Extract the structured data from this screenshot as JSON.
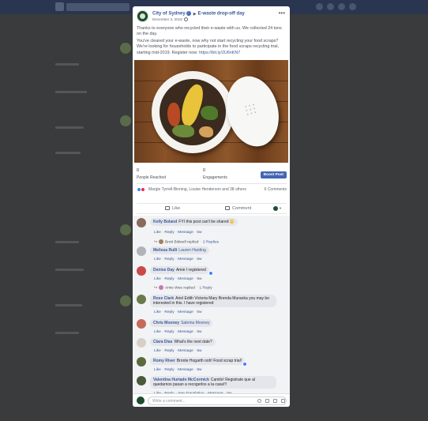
{
  "post": {
    "page_name": "City of Sydney",
    "event_name": "E-waste drop-off day",
    "date": "December 3, 2018",
    "paragraph_1": "Thanks to everyone who recycled their e-waste with us. We collected 24 tons on the day.",
    "paragraph_2": "You've cleared your e-waste, now why not start recycling your food scraps? We're looking for households to participate in the food scraps recycling trial, starting mid-2019. Register now:",
    "link": "https://bit.ly/2U6nKN7"
  },
  "stats": {
    "reached_count": "0",
    "reached_label": "People Reached",
    "engagements_count": "0",
    "engagements_label": "Engagements",
    "boost_label": "Boost Post"
  },
  "reactions": {
    "names": "Margie Tyrrell-Binning, Louise Henderson and 38 others",
    "comment_count": "6 Comments"
  },
  "actions": {
    "like": "Like",
    "comment": "Comment"
  },
  "comment_actions": {
    "like": "Like",
    "reply": "Reply",
    "message": "Message",
    "time": "5w",
    "see_translation": "See Translation"
  },
  "comments": [
    {
      "name": "Kelly Boland",
      "text": "FYI this post can't be shared 😳",
      "reply_name": "Brett Bidwell replied",
      "reply_count": "2 Replies"
    },
    {
      "name": "Melissa Rulli",
      "text": "Lauren Harding"
    },
    {
      "name": "Denise Day",
      "text": "Amie I registered",
      "reply_name": "Amie Wee replied",
      "reply_count": "1 Reply"
    },
    {
      "name": "Rose Clark",
      "text": "Ariel Edith Victoria Mary Brenda Muraoka you may be interested in this. I have registered"
    },
    {
      "name": "Chris Mooney",
      "text": "Sabrina Mooney"
    },
    {
      "name": "Clara Dias",
      "text": "What's the next date?"
    },
    {
      "name": "Romy River",
      "text": "Bronte Hogarth ooh! Food scrap trial!"
    },
    {
      "name": "Valentina Hurtado McCormick",
      "text": "Camilo! Registrate que al quedarnos pasan a recogerlos a la casa!!!"
    }
  ],
  "write_comment": {
    "placeholder": "Write a comment..."
  },
  "colors": {
    "facebook_blue": "#4267b2",
    "link_blue": "#385898",
    "page_avatar_green": "#1d4d2e"
  },
  "icons": [
    "verified-badge-icon",
    "globe-icon",
    "more-options-icon",
    "like-icon",
    "comment-icon",
    "love-reaction-icon",
    "like-reaction-icon",
    "reply-arrow-icon",
    "emoji-icon",
    "camera-icon",
    "gif-icon",
    "sticker-icon"
  ]
}
